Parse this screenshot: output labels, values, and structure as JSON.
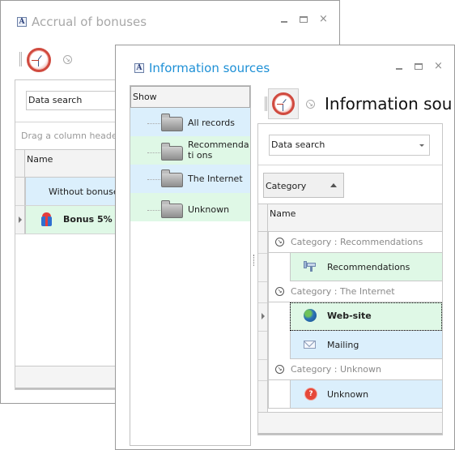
{
  "back_window": {
    "title": "Accrual of bonuses",
    "controls": {
      "minimize": "minimize",
      "maximize": "maximize",
      "close": "×"
    },
    "toolbar": {
      "clock_icon": "clock-icon",
      "arrow_icon": "↘"
    },
    "search": {
      "label": "Data search"
    },
    "group_hint": "Drag a column header he",
    "grid": {
      "columns": [
        "Name"
      ],
      "rows": [
        {
          "name": "Without bonuses",
          "bold": false
        },
        {
          "name": "Bonus 5%",
          "bold": true,
          "icon": "gift-icon"
        }
      ]
    }
  },
  "front_window": {
    "title": "Information sources",
    "controls": {
      "minimize": "minimize",
      "maximize": "maximize",
      "close": "×"
    },
    "tree": {
      "header": "Show",
      "items": [
        {
          "label": "All records"
        },
        {
          "label": "Recommendati ons"
        },
        {
          "label": "The Internet"
        },
        {
          "label": "Unknown"
        }
      ]
    },
    "toolbar": {
      "heading": "Information sou",
      "arrow_icon": "↘"
    },
    "search": {
      "label": "Data search"
    },
    "group_by": {
      "label": "Category"
    },
    "grid": {
      "columns": [
        "Name"
      ],
      "groups": [
        {
          "label": "Category : Recommendations",
          "rows": [
            {
              "name": "Recommendations",
              "icon": "megaphone-icon"
            }
          ]
        },
        {
          "label": "Category : The Internet",
          "rows": [
            {
              "name": "Web-site",
              "icon": "globe-icon",
              "bold": true
            },
            {
              "name": "Mailing",
              "icon": "mail-icon"
            }
          ]
        },
        {
          "label": "Category : Unknown",
          "rows": [
            {
              "name": "Unknown",
              "icon": "unknown-icon"
            }
          ]
        }
      ],
      "group_toggle_icon": "↘",
      "unknown_glyph": "?"
    }
  },
  "colors": {
    "front_title": "#1e90d6",
    "back_title": "#a8a8a8",
    "row_blue": "#dbeffc",
    "row_green": "#dff8e6"
  }
}
